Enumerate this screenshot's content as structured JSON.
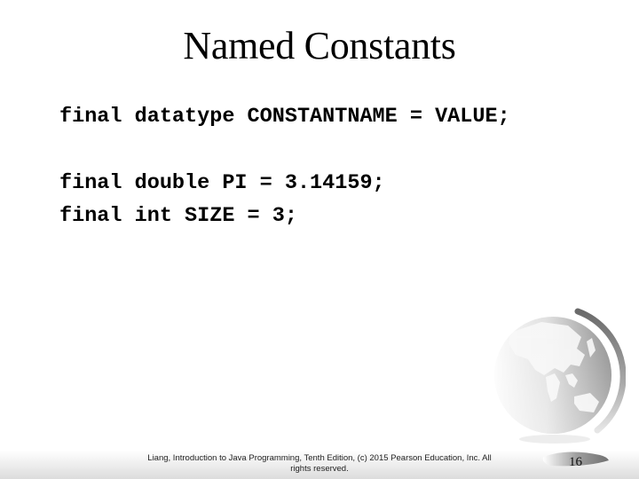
{
  "slide": {
    "title": "Named Constants",
    "code": {
      "syntax": "final datatype CONSTANTNAME = VALUE;",
      "examples": [
        "final double PI = 3.14159;",
        "final int SIZE = 3;"
      ]
    },
    "footer": {
      "citation_line1": "Liang, Introduction to Java Programming, Tenth Edition, (c) 2015 Pearson Education, Inc. All",
      "citation_line2": "rights reserved.",
      "page_number": "16"
    },
    "decoration": {
      "icon": "globe-icon",
      "colors": {
        "globe_dark": "#6e6e6e",
        "globe_light": "#f4f4f4",
        "footer_band": "#dcdcdc"
      }
    }
  }
}
